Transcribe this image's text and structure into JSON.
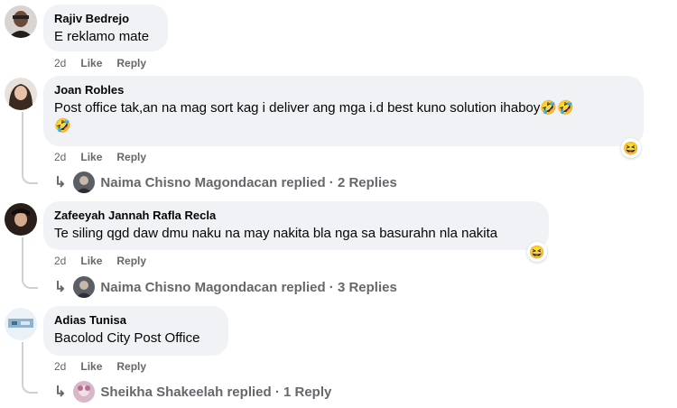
{
  "comments": [
    {
      "author": "Rajiv Bedrejo",
      "text": "E reklamo mate",
      "time": "2d",
      "like_label": "Like",
      "reply_label": "Reply"
    },
    {
      "author": "Joan Robles",
      "text_line1": "Post office tak,an na mag sort kag i deliver ang mga i.d best kuno solution ihaboy🤣🤣",
      "text_line2": "🤣",
      "time": "2d",
      "like_label": "Like",
      "reply_label": "Reply",
      "reaction": "😆",
      "replies_summary": "Naima Chisno Magondacan replied · 2 Replies"
    },
    {
      "author": "Zafeeyah Jannah Rafla Recla",
      "text": "Te siling qgd daw dmu naku na may nakita bla nga sa basurahn nla nakita",
      "time": "2d",
      "like_label": "Like",
      "reply_label": "Reply",
      "reaction": "😆",
      "replies_summary": "Naima Chisno Magondacan replied · 3 Replies"
    },
    {
      "author": "Adias Tunisa",
      "text": "Bacolod City Post Office",
      "time": "2d",
      "like_label": "Like",
      "reply_label": "Reply",
      "replies_summary": "Sheikha Shakeelah replied · 1 Reply"
    }
  ]
}
